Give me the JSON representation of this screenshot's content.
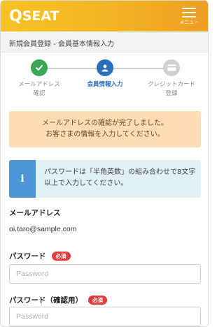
{
  "header": {
    "logo_q": "Q",
    "logo_rest": "SEAT",
    "menu_label": "メニュー"
  },
  "breadcrumb": "新規会員登録 - 会員基本情報入力",
  "steps": [
    {
      "label": "メールアドレス\n確認",
      "state": "done",
      "icon": "check-icon"
    },
    {
      "label": "会員情報入力",
      "state": "active",
      "icon": "user-icon"
    },
    {
      "label": "クレジットカード\n登録",
      "state": "todo",
      "icon": "credit-card-icon"
    }
  ],
  "notice": "メールアドレスの確認が完了しました。\nお客さまの情報を入力してください。",
  "info": {
    "icon_glyph": "i",
    "text": "パスワードは「半角英数」の組み合わせで8文字以上で入力してください。"
  },
  "email": {
    "label": "メールアドレス",
    "value": "oi.taro@sample.com"
  },
  "password": {
    "label": "パスワード",
    "required": "必須",
    "placeholder": "Password"
  },
  "password_confirm": {
    "label": "パスワード（確認用）",
    "required": "必須",
    "placeholder": "Password"
  },
  "colors": {
    "header": "#f3b323",
    "done": "#3aa757",
    "active": "#2a6ebc",
    "todo": "#d0d0d0",
    "notice_bg": "#fcdcb3",
    "info_bg": "#dff0f7",
    "info_badge": "#4d97d8",
    "required": "#e23b3b"
  }
}
